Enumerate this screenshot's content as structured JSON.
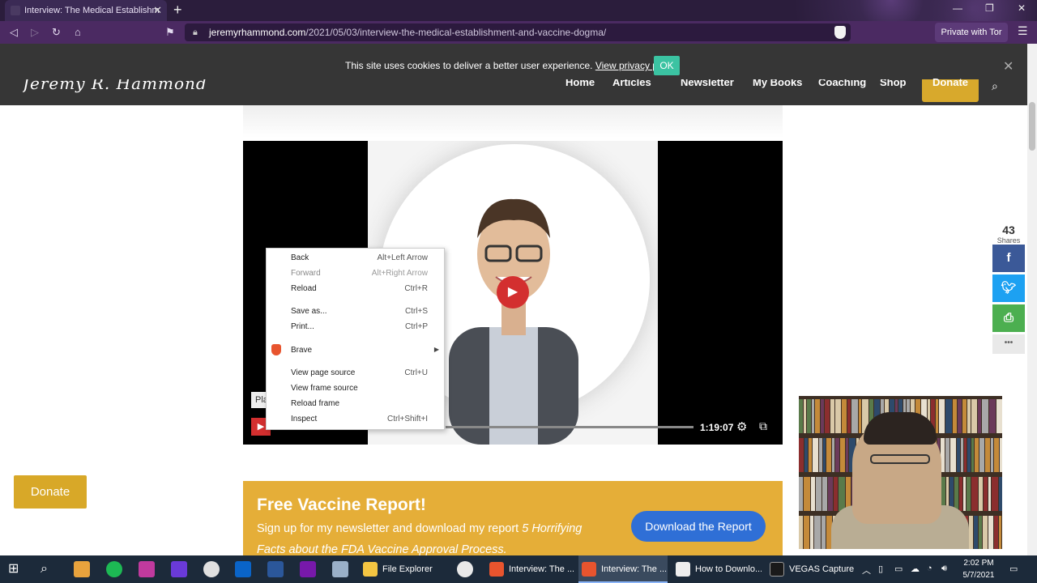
{
  "browser": {
    "tab_title": "Interview: The Medical Establishm",
    "url_host": "jeremyrhammond.com",
    "url_path": "/2021/05/03/interview-the-medical-establishment-and-vaccine-dogma/",
    "private_label": "Private with Tor"
  },
  "cookie": {
    "text": "This site uses cookies to deliver a better user experience.",
    "link": "View privacy policy.",
    "ok": "OK"
  },
  "site": {
    "logo": "Jeremy R. Hammond",
    "nav": [
      "Home",
      "Articles",
      "Newsletter",
      "My Books",
      "Coaching",
      "Shop"
    ],
    "donate": "Donate"
  },
  "video": {
    "duration": "1:19:07",
    "tooltip_fragment": "Pla"
  },
  "context_menu": {
    "items": [
      {
        "label": "Back",
        "shortcut": "Alt+Left Arrow"
      },
      {
        "label": "Forward",
        "shortcut": "Alt+Right Arrow"
      },
      {
        "label": "Reload",
        "shortcut": "Ctrl+R"
      },
      {
        "label": "Save as...",
        "shortcut": "Ctrl+S"
      },
      {
        "label": "Print...",
        "shortcut": "Ctrl+P"
      },
      {
        "label": "Brave",
        "shortcut": ""
      },
      {
        "label": "View page source",
        "shortcut": "Ctrl+U"
      },
      {
        "label": "View frame source",
        "shortcut": ""
      },
      {
        "label": "Reload frame",
        "shortcut": ""
      },
      {
        "label": "Inspect",
        "shortcut": "Ctrl+Shift+I"
      }
    ]
  },
  "share": {
    "count": "43",
    "label": "Shares",
    "buttons": [
      {
        "icon": "facebook-icon",
        "glyph": "f",
        "color": "#3b5998"
      },
      {
        "icon": "twitter-icon",
        "glyph": "t",
        "color": "#1da1f2"
      },
      {
        "icon": "print-icon",
        "glyph": "⎙",
        "color": "#4caf50"
      },
      {
        "icon": "more-icon",
        "glyph": "•••",
        "color": "#e9e9e9"
      }
    ]
  },
  "donate_float": "Donate",
  "report": {
    "title": "Free Vaccine Report!",
    "text": "Sign up for my newsletter and download my report",
    "text_italic": "5 Horrifying Facts about the FDA Vaccine Approval Process.",
    "button": "Download the Report"
  },
  "taskbar": {
    "apps": [
      {
        "label": "File Explorer"
      },
      {
        "label": "Interview: The ..."
      },
      {
        "label": "Interview: The ..."
      },
      {
        "label": "How to Downlo..."
      },
      {
        "label": "VEGAS Capture"
      }
    ],
    "time": "2:02 PM",
    "date": "5/7/2021"
  },
  "colors": {
    "accent_gold": "#e5ae38",
    "brave_purple": "#4b2a62",
    "download_blue": "#2f6fd6"
  }
}
